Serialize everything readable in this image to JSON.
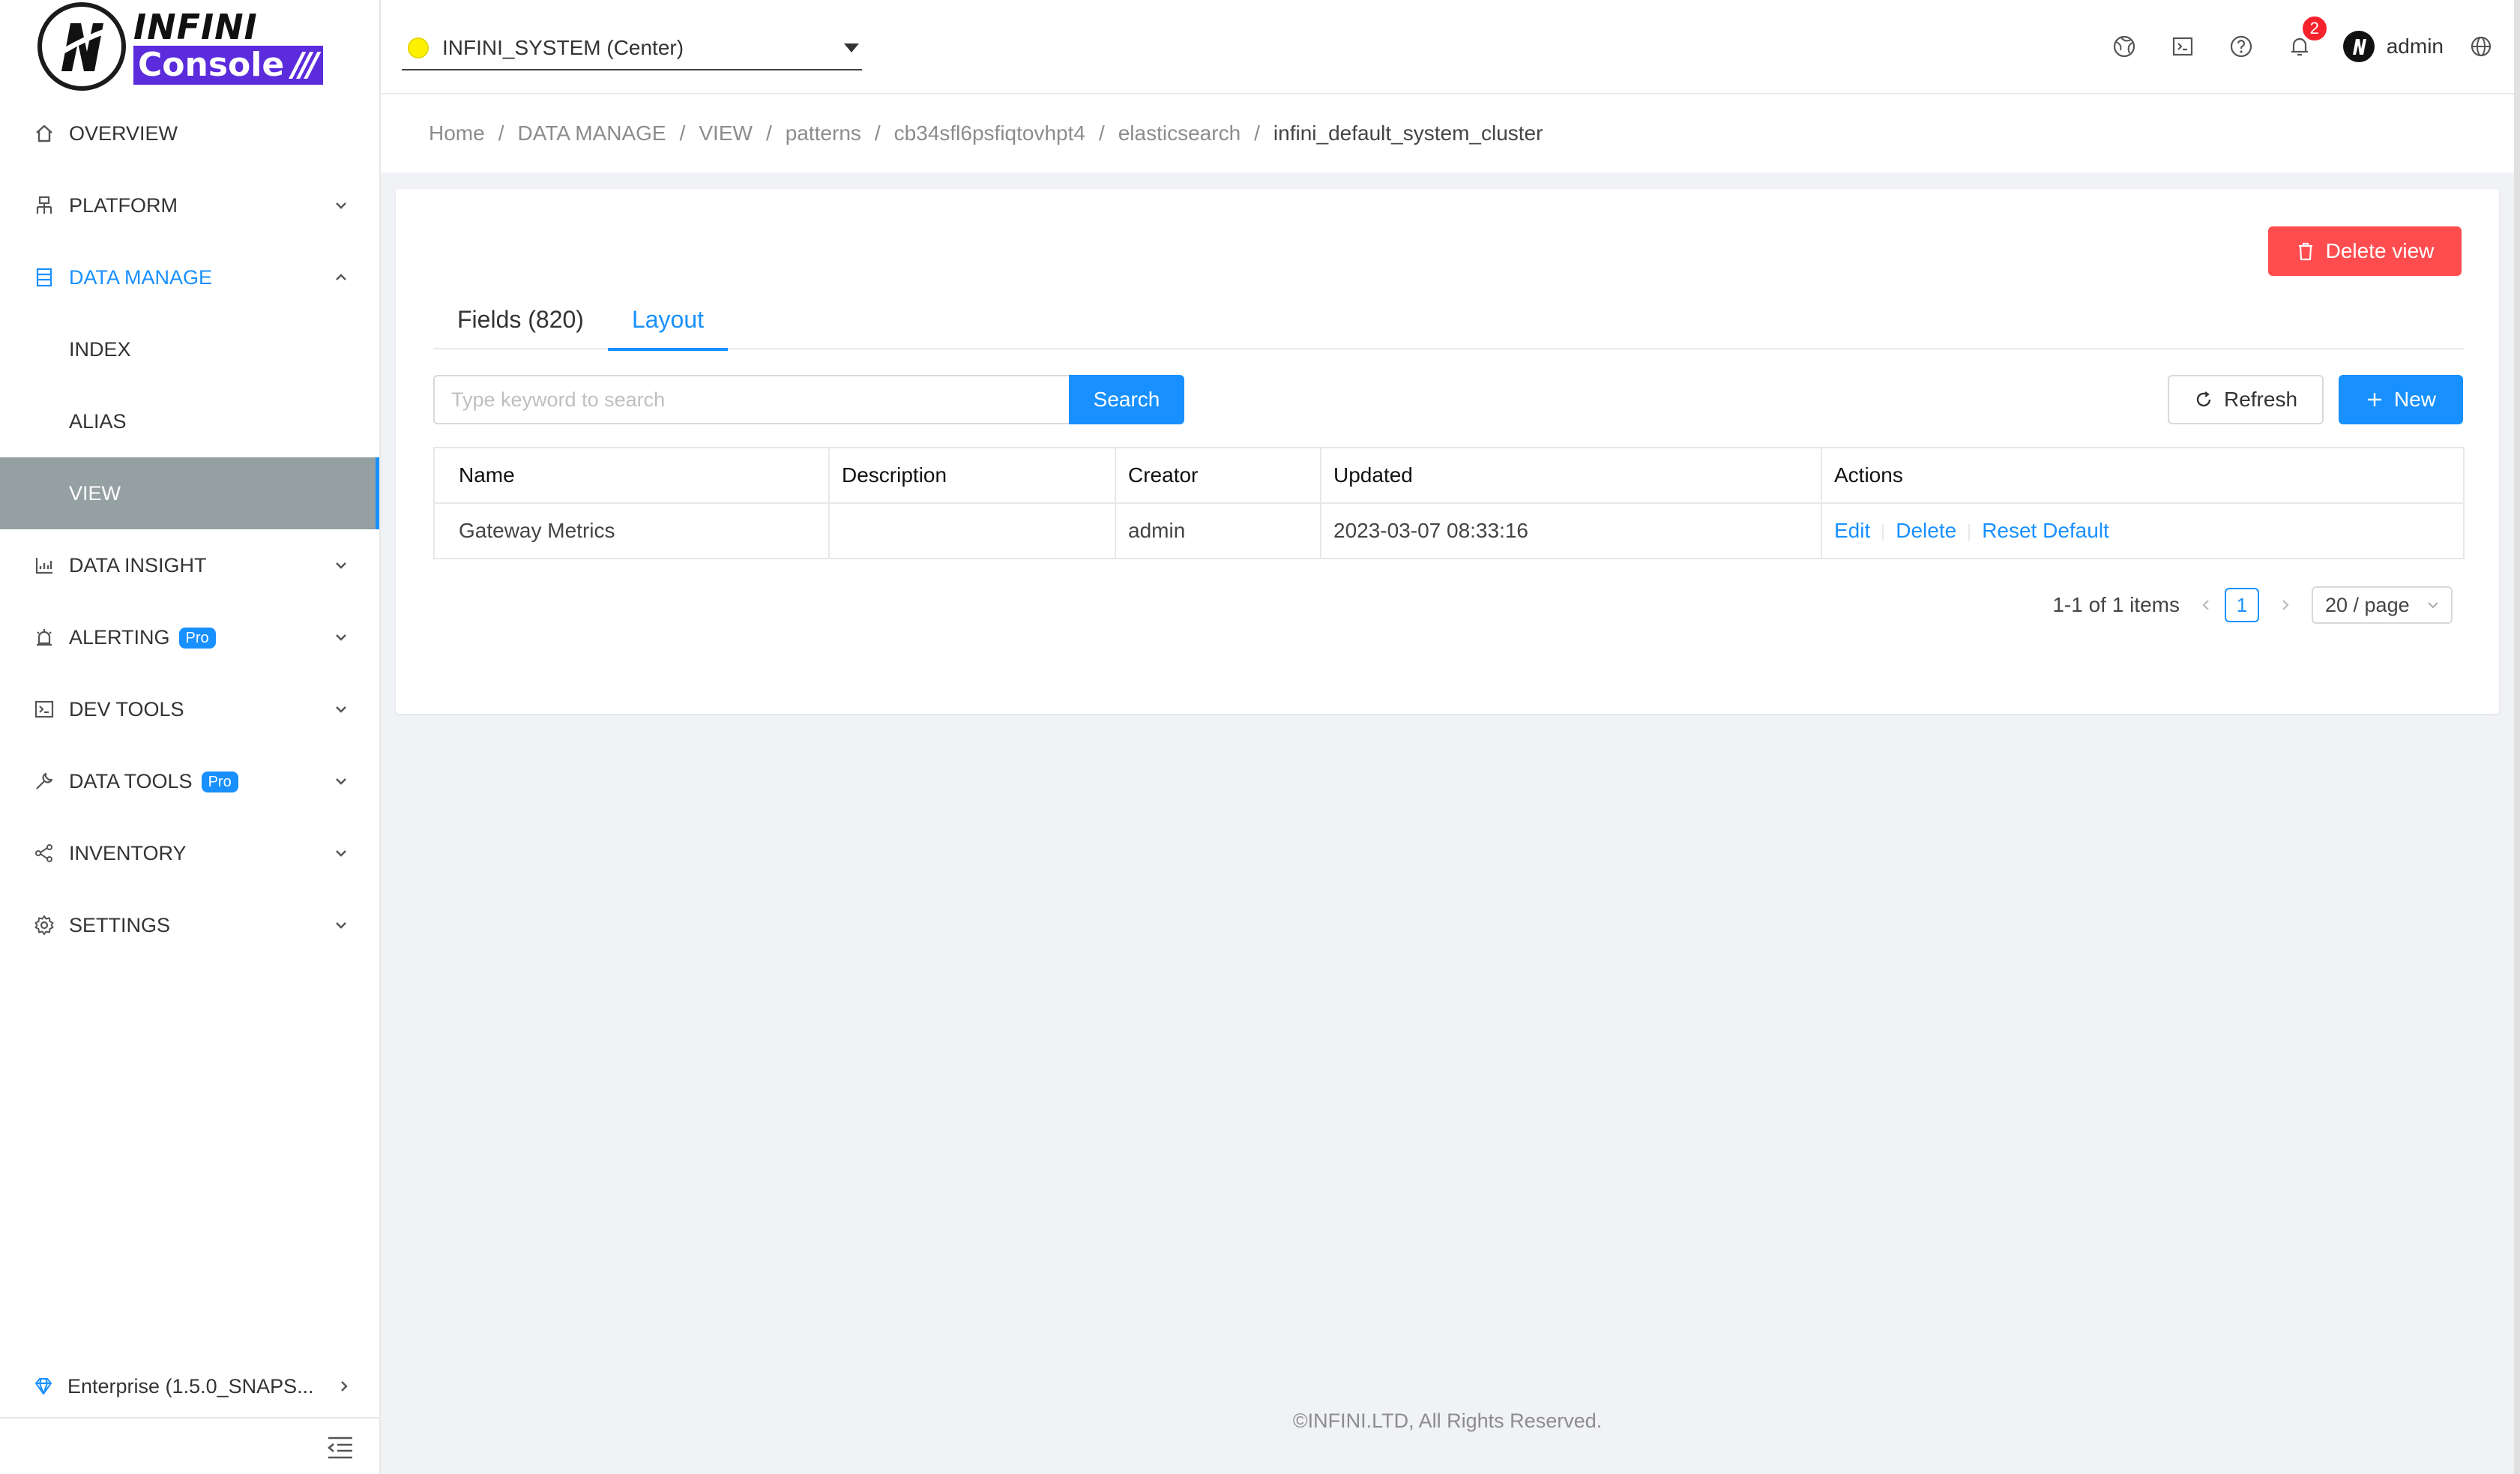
{
  "brand": {
    "name_top": "INFINI",
    "name_bottom": "Console",
    "slashes": "///"
  },
  "sidebar": {
    "items": [
      {
        "label": "OVERVIEW",
        "icon": "home-icon"
      },
      {
        "label": "PLATFORM",
        "icon": "platform-icon"
      },
      {
        "label": "DATA MANAGE",
        "icon": "data-manage-icon"
      },
      {
        "label": "DATA INSIGHT",
        "icon": "chart-icon"
      },
      {
        "label": "ALERTING",
        "icon": "alarm-icon",
        "badge": "Pro"
      },
      {
        "label": "DEV TOOLS",
        "icon": "terminal-icon"
      },
      {
        "label": "DATA TOOLS",
        "icon": "wrench-icon",
        "badge": "Pro"
      },
      {
        "label": "INVENTORY",
        "icon": "share-icon"
      },
      {
        "label": "SETTINGS",
        "icon": "gear-icon"
      }
    ],
    "sub_items": [
      "INDEX",
      "ALIAS",
      "VIEW"
    ],
    "selected_sub": "VIEW",
    "edition": "Enterprise (1.5.0_SNAPS..."
  },
  "header": {
    "cluster": "INFINI_SYSTEM (Center)",
    "notifications_count": "2",
    "user": "admin"
  },
  "breadcrumb": [
    "Home",
    "DATA MANAGE",
    "VIEW",
    "patterns",
    "cb34sfl6psfiqtovhpt4",
    "elasticsearch",
    "infini_default_system_cluster"
  ],
  "card": {
    "delete_view_label": "Delete view",
    "tabs": [
      "Fields (820)",
      "Layout"
    ],
    "active_tab": "Layout",
    "search": {
      "placeholder": "Type keyword to search",
      "value": "",
      "button": "Search"
    },
    "refresh_label": "Refresh",
    "new_label": "New",
    "table": {
      "headers": [
        "Name",
        "Description",
        "Creator",
        "Updated",
        "Actions"
      ],
      "rows": [
        {
          "name": "Gateway Metrics",
          "description": "",
          "creator": "admin",
          "updated": "2023-03-07 08:33:16",
          "actions": [
            "Edit",
            "Delete",
            "Reset Default"
          ]
        }
      ]
    },
    "pagination": {
      "summary": "1-1 of 1 items",
      "current_page": "1",
      "page_size": "20 / page"
    }
  },
  "footer": "©INFINI.LTD, All Rights Reserved.",
  "colors": {
    "primary": "#1890ff",
    "danger": "#ff4d4f",
    "selected_bg": "#95a0a3",
    "brand_purple": "#5b2bdc",
    "status_yellow": "#fff200"
  }
}
